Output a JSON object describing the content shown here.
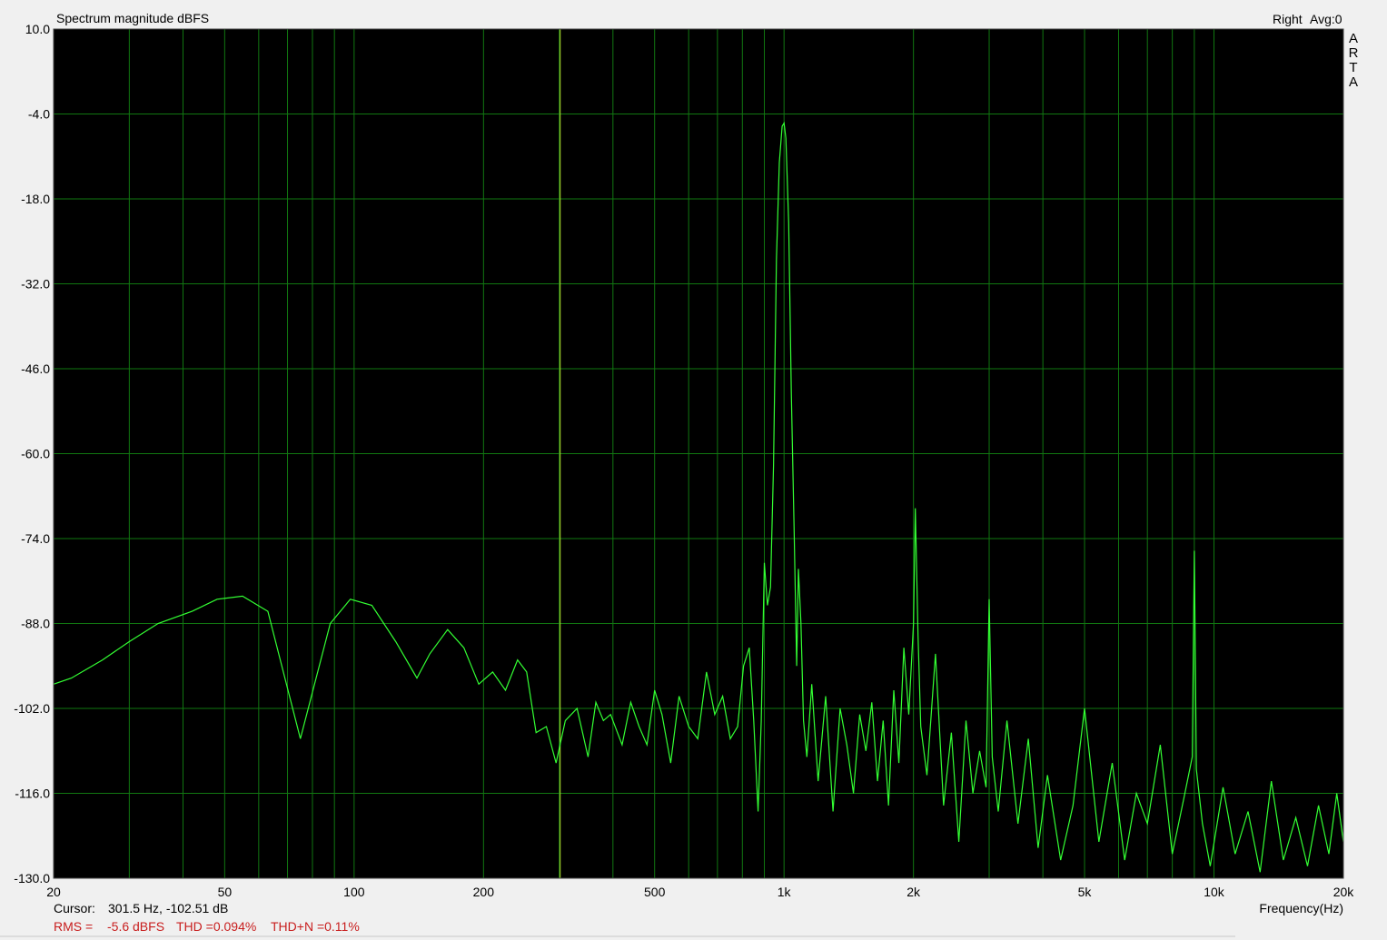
{
  "chart_data": {
    "type": "line",
    "title": "Spectrum magnitude dBFS",
    "channel": "Right",
    "avg": "Avg:0",
    "logo": [
      "A",
      "R",
      "T",
      "A"
    ],
    "xlabel": "Frequency(Hz)",
    "ylabel": "",
    "x_scale": "log",
    "xlim": [
      20,
      20000
    ],
    "ylim": [
      -130,
      10
    ],
    "grid": true,
    "y_ticks": [
      10.0,
      -4.0,
      -18.0,
      -32.0,
      -46.0,
      -60.0,
      -74.0,
      -88.0,
      -102.0,
      -116.0,
      -130.0
    ],
    "y_tick_labels": [
      "10.0",
      "-4.0",
      "-18.0",
      "-32.0",
      "-46.0",
      "-60.0",
      "-74.0",
      "-88.0",
      "-102.0",
      "-116.0",
      "-130.0"
    ],
    "x_ticks": [
      20,
      50,
      100,
      200,
      500,
      1000,
      2000,
      5000,
      10000,
      20000
    ],
    "x_tick_labels": [
      "20",
      "50",
      "100",
      "200",
      "500",
      "1k",
      "2k",
      "5k",
      "10k",
      "20k"
    ],
    "cursor_hz": 301.5,
    "series": [
      {
        "color": "#33ff33",
        "x": [
          20,
          22,
          26,
          30,
          35,
          42,
          48,
          55,
          63,
          75,
          88,
          98,
          110,
          125,
          140,
          150,
          165,
          180,
          195,
          210,
          225,
          240,
          252,
          265,
          280,
          295,
          310,
          330,
          350,
          365,
          380,
          395,
          420,
          440,
          460,
          480,
          500,
          520,
          545,
          570,
          600,
          630,
          660,
          690,
          720,
          750,
          780,
          805,
          830,
          850,
          870,
          885,
          900,
          915,
          930,
          945,
          960,
          975,
          990,
          1000,
          1010,
          1025,
          1040,
          1055,
          1070,
          1080,
          1095,
          1110,
          1130,
          1160,
          1200,
          1250,
          1300,
          1350,
          1400,
          1450,
          1500,
          1550,
          1600,
          1650,
          1700,
          1750,
          1800,
          1850,
          1900,
          1950,
          2000,
          2020,
          2050,
          2080,
          2150,
          2250,
          2350,
          2450,
          2550,
          2650,
          2750,
          2850,
          2950,
          3000,
          3050,
          3150,
          3300,
          3500,
          3700,
          3900,
          4100,
          4400,
          4700,
          5000,
          5400,
          5800,
          6200,
          6600,
          7000,
          7500,
          8000,
          8500,
          8900,
          9000,
          9100,
          9400,
          9800,
          10500,
          11200,
          12000,
          12800,
          13600,
          14500,
          15500,
          16500,
          17500,
          18500,
          19300,
          20000
        ],
        "values": [
          -98,
          -97,
          -94,
          -91,
          -88,
          -86,
          -84,
          -83.5,
          -86,
          -107,
          -88,
          -84,
          -85,
          -91,
          -97,
          -93,
          -89,
          -92,
          -98,
          -96,
          -99,
          -94,
          -96,
          -106,
          -105,
          -111,
          -104,
          -102,
          -110,
          -101,
          -104,
          -103,
          -108,
          -101,
          -105,
          -108,
          -99,
          -103,
          -111,
          -100,
          -105,
          -107,
          -96,
          -103,
          -100,
          -107,
          -105,
          -95,
          -92,
          -104,
          -119,
          -104,
          -78,
          -85,
          -82,
          -62,
          -28,
          -12,
          -6,
          -5.5,
          -8,
          -22,
          -50,
          -72,
          -95,
          -79,
          -88,
          -104,
          -110,
          -98,
          -114,
          -100,
          -119,
          -102,
          -108,
          -116,
          -103,
          -109,
          -101,
          -114,
          -104,
          -118,
          -99,
          -111,
          -92,
          -103,
          -88,
          -69,
          -90,
          -105,
          -113,
          -93,
          -118,
          -106,
          -124,
          -104,
          -116,
          -109,
          -115,
          -84,
          -110,
          -119,
          -104,
          -121,
          -107,
          -125,
          -113,
          -127,
          -118,
          -102,
          -124,
          -111,
          -127,
          -116,
          -121,
          -108,
          -126,
          -117,
          -110,
          -76,
          -112,
          -121,
          -128,
          -115,
          -126,
          -119,
          -129,
          -114,
          -127,
          -120,
          -128,
          -118,
          -126,
          -116,
          -124
        ]
      }
    ]
  },
  "footer": {
    "cursor_label": "Cursor:",
    "cursor_value": "301.5 Hz, -102.51 dB",
    "rms_label": "RMS =",
    "rms_value": "-5.6 dBFS",
    "thd": "THD =0.094%",
    "thdn": "THD+N =0.11%"
  },
  "colors": {
    "plot_bg": "#000000",
    "grid": "#117711",
    "trace": "#33ff33",
    "cursor": "#bbee33",
    "footer_red": "#c81e1e",
    "page_bg": "#f0f0f0"
  }
}
